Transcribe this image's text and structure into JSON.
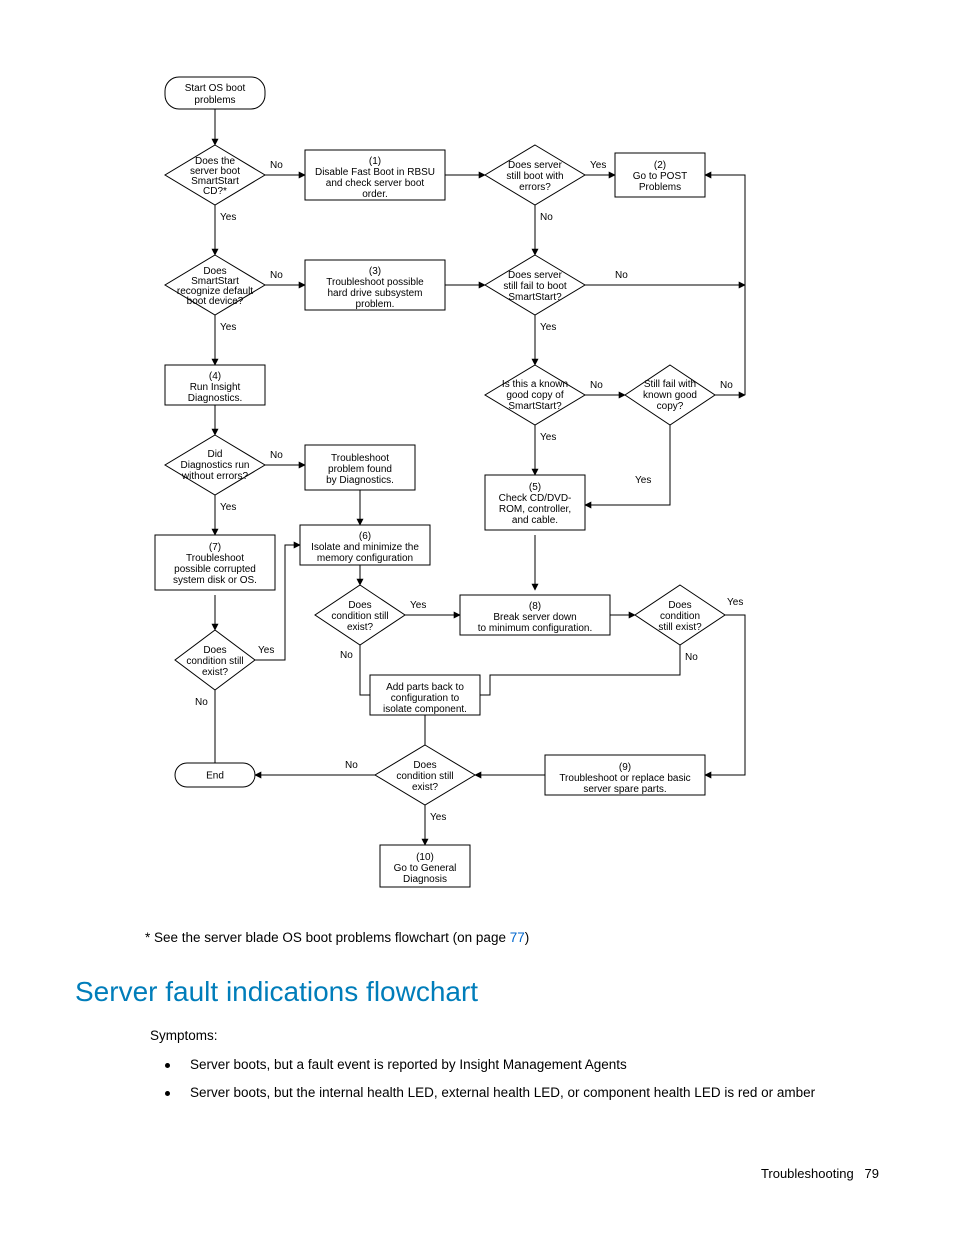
{
  "chart_data": {
    "type": "flowchart",
    "title": "OS boot problems flowchart",
    "nodes": {
      "start": {
        "shape": "terminator",
        "text": "Start OS boot\nproblems"
      },
      "d_bootcd": {
        "shape": "decision",
        "text": "Does the\nserver boot\nSmartStart\nCD?*"
      },
      "p1": {
        "shape": "process",
        "text": "(1)\nDisable Fast Boot in RBSU\nand check server boot\norder."
      },
      "d_errors": {
        "shape": "decision",
        "text": "Does server\nstill boot with\nerrors?"
      },
      "p2": {
        "shape": "process",
        "text": "(2)\nGo to POST\nProblems"
      },
      "d_recog": {
        "shape": "decision",
        "text": "Does\nSmartStart\nrecognize default\nboot device?"
      },
      "p3": {
        "shape": "process",
        "text": "(3)\nTroubleshoot possible\nhard drive subsystem\nproblem."
      },
      "d_failboot": {
        "shape": "decision",
        "text": "Does server\nstill fail to boot\nSmartStart?"
      },
      "p4": {
        "shape": "process",
        "text": "(4)\nRun Insight\nDiagnostics."
      },
      "d_known": {
        "shape": "decision",
        "text": "Is this a known\ngood copy of\nSmartStart?"
      },
      "d_stillfail": {
        "shape": "decision",
        "text": "Still fail with\nknown good\ncopy?"
      },
      "d_diag": {
        "shape": "decision",
        "text": "Did\nDiagnostics run\nwithout errors?"
      },
      "p_diagfix": {
        "shape": "process",
        "text": "Troubleshoot\nproblem found\nby Diagnostics."
      },
      "p5": {
        "shape": "process",
        "text": "(5)\nCheck CD/DVD-\nROM, controller,\nand cable."
      },
      "p6": {
        "shape": "process",
        "text": "(6)\nIsolate and minimize the\nmemory configuration"
      },
      "p7": {
        "shape": "process",
        "text": "(7)\nTroubleshoot\npossible corrupted\nsystem disk or OS."
      },
      "d_cond1": {
        "shape": "decision",
        "text": "Does\ncondition still\nexist?"
      },
      "p8": {
        "shape": "process",
        "text": "(8)\nBreak server down\nto minimum configuration."
      },
      "d_cond2": {
        "shape": "decision",
        "text": "Does\ncondition\nstill exist?"
      },
      "d_cond3": {
        "shape": "decision",
        "text": "Does\ncondition still\nexist?"
      },
      "p_addback": {
        "shape": "process",
        "text": "Add parts back to\nconfiguration to\nisolate component."
      },
      "d_cond4": {
        "shape": "decision",
        "text": "Does\ncondition still\nexist?"
      },
      "p9": {
        "shape": "process",
        "text": "(9)\nTroubleshoot or replace basic\nserver spare parts."
      },
      "end": {
        "shape": "terminator",
        "text": "End"
      },
      "p10": {
        "shape": "process",
        "text": "(10)\nGo to General\nDiagnosis"
      }
    },
    "edges": [
      {
        "from": "start",
        "to": "d_bootcd"
      },
      {
        "from": "d_bootcd",
        "to": "p1",
        "label": "No"
      },
      {
        "from": "d_bootcd",
        "to": "d_recog",
        "label": "Yes"
      },
      {
        "from": "p1",
        "to": "d_errors"
      },
      {
        "from": "d_errors",
        "to": "p2",
        "label": "Yes"
      },
      {
        "from": "d_errors",
        "to": "d_failboot",
        "label": "No"
      },
      {
        "from": "d_recog",
        "to": "p3",
        "label": "No"
      },
      {
        "from": "d_recog",
        "to": "p4",
        "label": "Yes"
      },
      {
        "from": "p3",
        "to": "d_failboot"
      },
      {
        "from": "d_failboot",
        "to": "right-bus",
        "label": "No"
      },
      {
        "from": "d_failboot",
        "to": "d_known",
        "label": "Yes"
      },
      {
        "from": "d_known",
        "to": "d_stillfail",
        "label": "No"
      },
      {
        "from": "d_known",
        "to": "p5",
        "label": "Yes"
      },
      {
        "from": "d_stillfail",
        "to": "right-bus",
        "label": "No"
      },
      {
        "from": "d_stillfail",
        "to": "p5",
        "label": "Yes"
      },
      {
        "from": "p4",
        "to": "d_diag"
      },
      {
        "from": "d_diag",
        "to": "p_diagfix",
        "label": "No"
      },
      {
        "from": "d_diag",
        "to": "p7",
        "label": "Yes"
      },
      {
        "from": "p_diagfix",
        "to": "p6"
      },
      {
        "from": "p5",
        "to": "p8"
      },
      {
        "from": "p6",
        "to": "d_cond1"
      },
      {
        "from": "d_cond1",
        "to": "p8",
        "label": "Yes"
      },
      {
        "from": "d_cond1",
        "to": "p_addback-bus",
        "label": "No"
      },
      {
        "from": "p7",
        "to": "d_cond3"
      },
      {
        "from": "d_cond3",
        "to": "p6",
        "label": "Yes"
      },
      {
        "from": "d_cond3",
        "to": "end-bus",
        "label": "No"
      },
      {
        "from": "p8",
        "to": "d_cond2"
      },
      {
        "from": "d_cond2",
        "to": "p9",
        "label": "Yes"
      },
      {
        "from": "d_cond2",
        "to": "p_addback",
        "label": "No"
      },
      {
        "from": "p_addback",
        "to": "d_cond4"
      },
      {
        "from": "d_cond4",
        "to": "end",
        "label": "No"
      },
      {
        "from": "d_cond4",
        "to": "p10",
        "label": "Yes"
      },
      {
        "from": "p9",
        "to": "d_cond4"
      }
    ]
  },
  "labels": {
    "yes": "Yes",
    "no": "No"
  },
  "footnote_prefix": "* See the server blade OS boot problems flowchart (on page ",
  "footnote_link": "77",
  "footnote_suffix": ")",
  "heading": "Server fault indications flowchart",
  "symptoms_label": "Symptoms:",
  "bullets": {
    "b1": "Server boots, but a fault event is reported by Insight Management Agents",
    "b2": "Server boots, but the internal health LED, external health LED, or component health LED is red or amber"
  },
  "footer_section": "Troubleshooting",
  "footer_page": "79"
}
